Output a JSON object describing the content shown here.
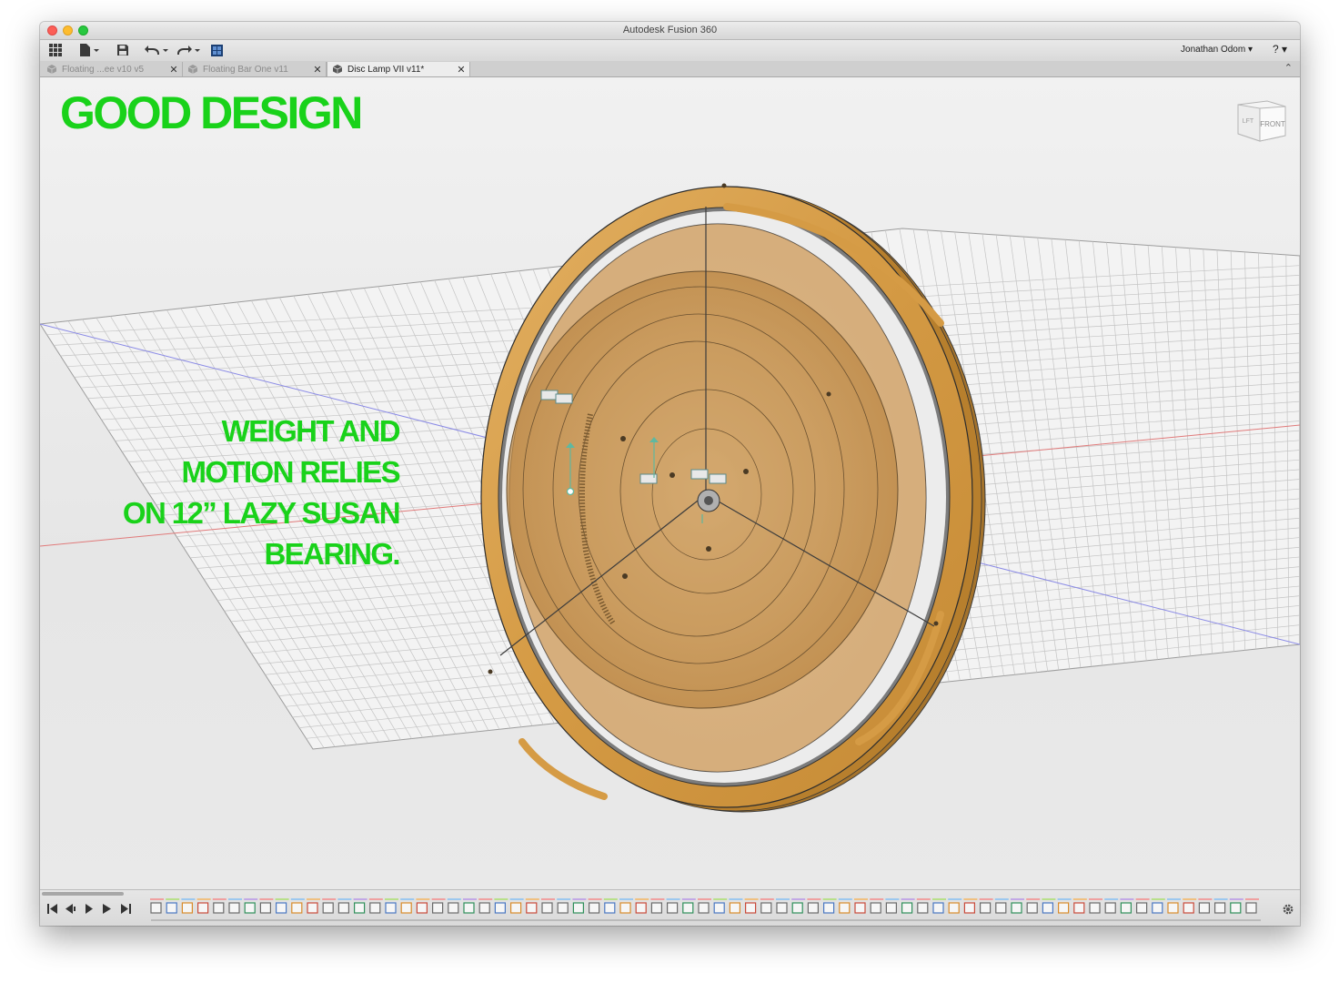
{
  "window": {
    "title": "Autodesk Fusion 360"
  },
  "toolbar": {
    "grid_icon": "app-grid-icon",
    "file_icon": "file-icon",
    "save_icon": "save-icon",
    "undo_icon": "undo-icon",
    "redo_icon": "redo-icon",
    "data_panel_icon": "data-panel-icon",
    "user_name": "Jonathan Odom ▾",
    "help_label": "? ▾"
  },
  "tabs": [
    {
      "label": "Floating ...ee v10 v5",
      "active": false
    },
    {
      "label": "Floating Bar One v11",
      "active": false
    },
    {
      "label": "Disc Lamp VII v11*",
      "active": true
    }
  ],
  "tab_close_glyph": "✕",
  "tab_collapse_glyph": "⌃",
  "overlay": {
    "title": "GOOD DESIGN",
    "caption_lines": [
      "WEIGHT AND",
      "MOTION RELIES",
      "ON 12” LAZY SUSAN",
      "BEARING."
    ],
    "color": "#19d21a"
  },
  "viewcube": {
    "front_label": "FRONT",
    "left_label": "LFT"
  },
  "colors": {
    "wood": "#d9a24f",
    "wood_dark": "#b77f2d",
    "grid_line": "#b9b9b9",
    "axis_red": "#e07a7a",
    "axis_blue": "#8a8ae6",
    "accent_text": "#19d21a"
  },
  "timeline": {
    "controls": [
      "go-to-start-icon",
      "step-back-icon",
      "play-icon",
      "step-forward-icon",
      "go-to-end-icon"
    ],
    "settings_icon": "settings-gear-icon"
  }
}
